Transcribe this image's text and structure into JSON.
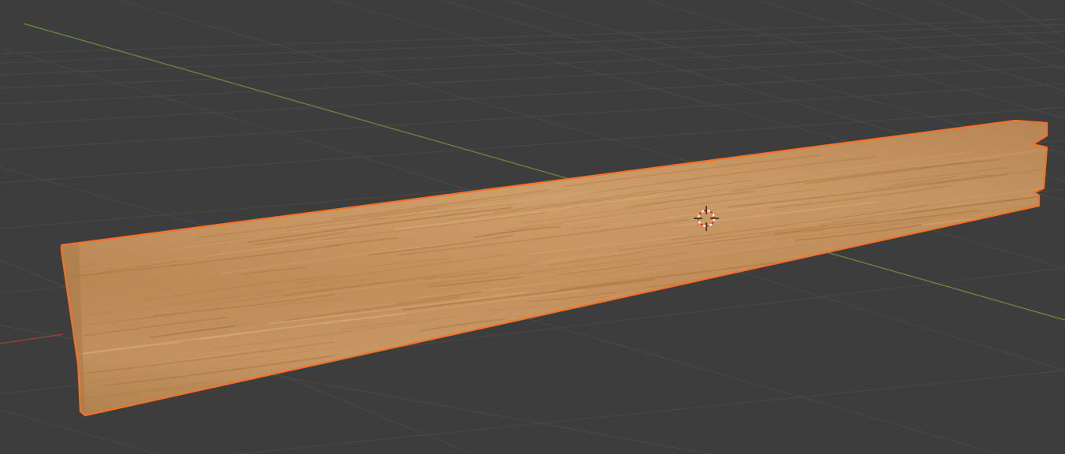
{
  "viewport": {
    "background_color": "#3d3d3d",
    "grid_color": "#4a4a4a",
    "grid_major_color": "#525252",
    "x_axis_color": "#a04141",
    "y_axis_color": "#6b8e3a",
    "view": "perspective"
  },
  "object": {
    "type": "mesh",
    "material": "wood-plank",
    "selected": true,
    "outline_color": "#f0722b",
    "base_color": "#c89561",
    "dark_color": "#a87840",
    "light_color": "#d6aa78"
  },
  "cursor_3d": {
    "ring_color_a": "#ffffff",
    "ring_color_b": "#e0322a",
    "crosshair_color": "#111111"
  }
}
